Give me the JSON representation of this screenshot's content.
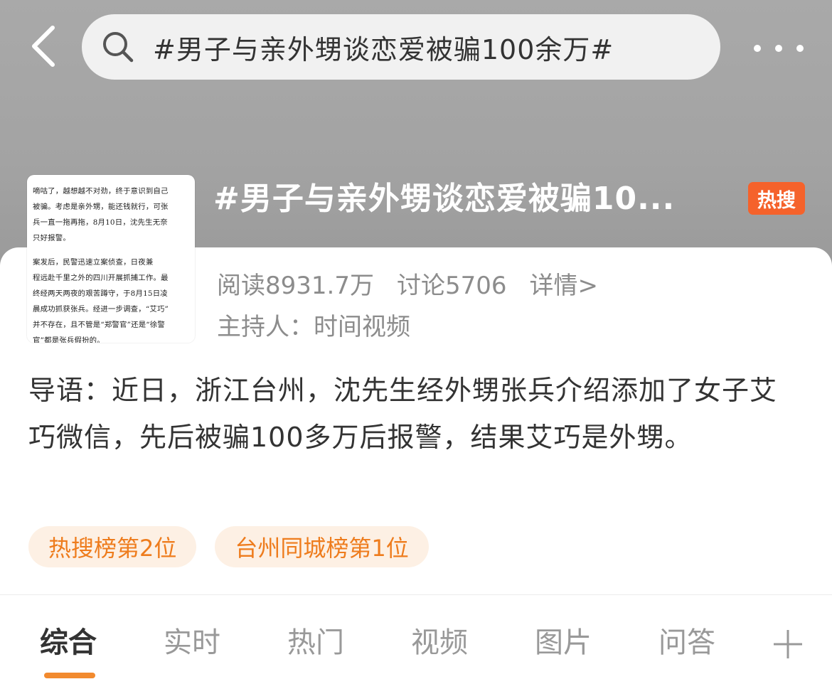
{
  "header": {
    "search_text": "#男子与亲外甥谈恋爱被骗100余万#"
  },
  "topic": {
    "title": "#男子与亲外甥谈恋爱被骗10...",
    "badge": "热搜",
    "stats": {
      "reads": "阅读8931.7万",
      "discussions": "讨论5706",
      "detail": "详情>"
    },
    "host": "主持人：时间视频"
  },
  "thumbnail": {
    "paragraph1": "嘀咕了，越想越不对劲，终于意识到自己\n被骗。考虑是亲外甥，能还钱就行，可张\n兵一直一拖再拖，8月10日，沈先生无奈\n只好报警。",
    "paragraph2": "    案发后，民警迅速立案侦查，日夜兼\n程远赴千里之外的四川开展抓捕工作。最\n终经两天两夜的艰苦蹲守，于8月15日凌\n晨成功抓获张兵。经进一步调查，“艾巧”\n并不存在，且不管是“郑警官”还是“徐警\n官”都是张兵假扮的。"
  },
  "intro": "导语：近日，浙江台州，沈先生经外甥张兵介绍添加了女子艾巧微信，先后被骗100多万后报警，结果艾巧是外甥。",
  "tags": [
    "热搜榜第2位",
    "台州同城榜第1位"
  ],
  "tabs": [
    "综合",
    "实时",
    "热门",
    "视频",
    "图片",
    "问答"
  ],
  "icons": {
    "back": "back-arrow-icon",
    "search": "search-icon",
    "more": "more-dots-icon",
    "add": "plus-icon"
  },
  "colors": {
    "header_bg": "#a6a6a6",
    "hot_badge": "#f5622b",
    "tag_bg": "#fdf0e4",
    "tag_text": "#ee7c1d",
    "tab_underline": "#f28a2e"
  }
}
